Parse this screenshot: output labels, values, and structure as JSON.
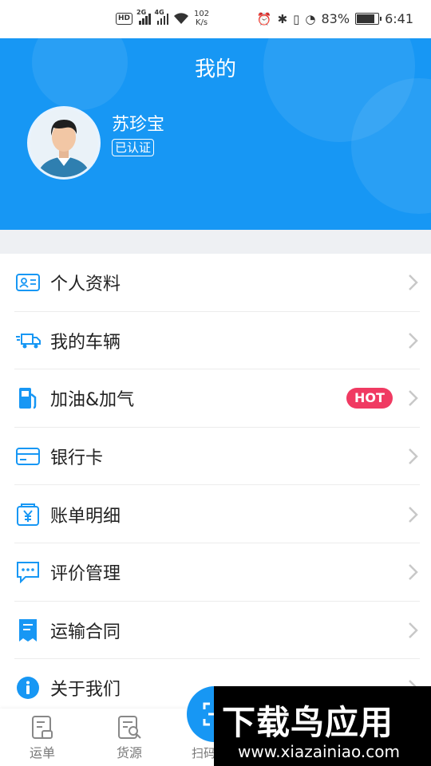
{
  "status_bar": {
    "hd": "HD",
    "sim1": "2G",
    "sim2": "4G",
    "speed_value": "102",
    "speed_unit": "K/s",
    "battery": "83%",
    "battery_level": 0.83,
    "time": "6:41"
  },
  "header": {
    "title": "我的",
    "username": "苏珍宝",
    "verified_badge": "已认证",
    "background_color": "#1797f4"
  },
  "menu": {
    "items": [
      {
        "label": "个人资料",
        "icon": "id-card-icon"
      },
      {
        "label": "我的车辆",
        "icon": "truck-icon"
      },
      {
        "label": "加油&加气",
        "icon": "fuel-pump-icon",
        "badge": "HOT"
      },
      {
        "label": "银行卡",
        "icon": "bank-card-icon"
      },
      {
        "label": "账单明细",
        "icon": "bill-yen-icon"
      },
      {
        "label": "评价管理",
        "icon": "comment-icon"
      },
      {
        "label": "运输合同",
        "icon": "contract-icon"
      },
      {
        "label": "关于我们",
        "icon": "info-icon"
      }
    ],
    "accent_color": "#1797f4",
    "hot_color": "#f03a62"
  },
  "bottom_nav": {
    "items": [
      {
        "label": "运单",
        "icon": "waybill-icon"
      },
      {
        "label": "货源",
        "icon": "cargo-search-icon"
      },
      {
        "label": "扫码",
        "icon": "scan-icon"
      }
    ]
  },
  "watermark": {
    "title": "下载鸟应用",
    "url": "www.xiazainiao.com"
  }
}
